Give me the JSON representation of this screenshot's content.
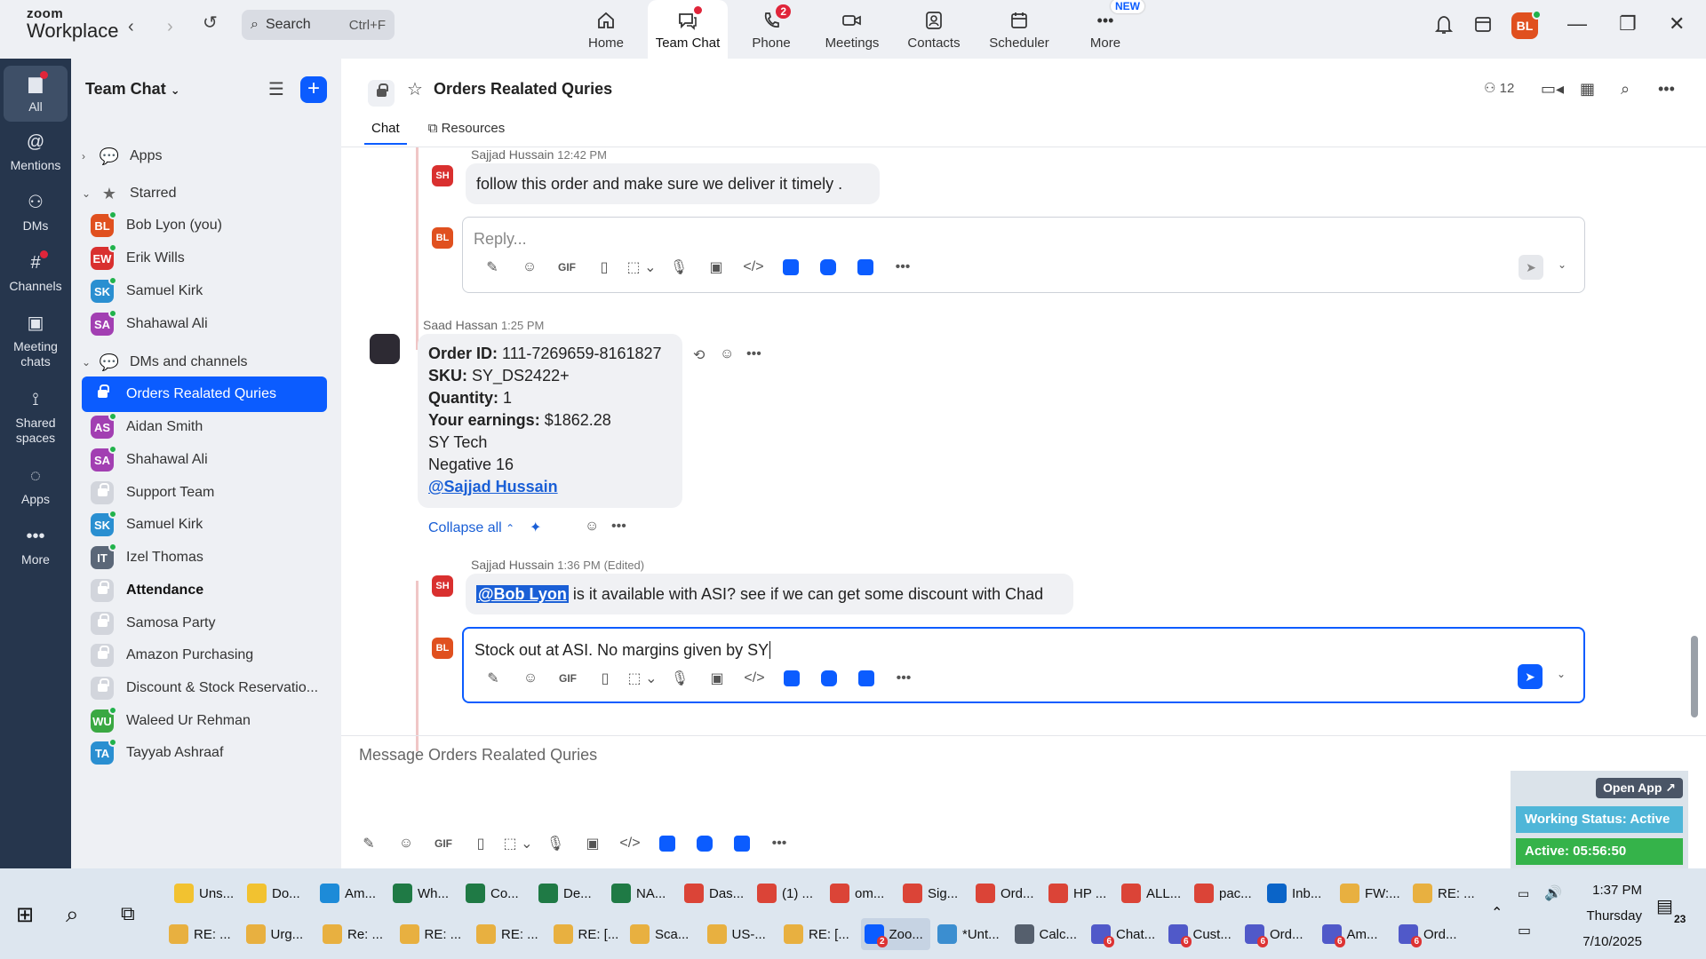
{
  "app": {
    "logo_line1": "zoom",
    "logo_line2": "Workplace"
  },
  "search": {
    "label": "Search",
    "shortcut": "Ctrl+F"
  },
  "nav": [
    {
      "label": "Home",
      "icon": "home-icon"
    },
    {
      "label": "Team Chat",
      "icon": "chat-icon",
      "active": true
    },
    {
      "label": "Phone",
      "icon": "phone-icon",
      "badge": "2"
    },
    {
      "label": "Meetings",
      "icon": "video-icon"
    },
    {
      "label": "Contacts",
      "icon": "contacts-icon"
    },
    {
      "label": "Scheduler",
      "icon": "calendar-icon"
    },
    {
      "label": "More",
      "icon": "more-icon",
      "tag": "NEW"
    }
  ],
  "user": {
    "initials": "BL"
  },
  "rail": [
    {
      "label": "All",
      "icon": "chat-bubble-icon"
    },
    {
      "label": "Mentions",
      "icon": "at-icon"
    },
    {
      "label": "DMs",
      "icon": "people-icon"
    },
    {
      "label": "Channels",
      "icon": "hash-icon"
    },
    {
      "label": "Meeting chats",
      "icon": "calendar-icon"
    },
    {
      "label": "Shared spaces",
      "icon": "share-icon"
    },
    {
      "label": "Apps",
      "icon": "apps-icon"
    },
    {
      "label": "More",
      "icon": "more-icon"
    }
  ],
  "sidebar": {
    "title": "Team Chat",
    "items": [
      {
        "kind": "group",
        "label": "Apps",
        "chevron": "›",
        "icon": "💬"
      },
      {
        "kind": "group",
        "label": "Starred",
        "chevron": "⌄",
        "icon": "★"
      },
      {
        "kind": "user",
        "label": "Bob Lyon (you)",
        "initials": "BL",
        "color": "#e0501f"
      },
      {
        "kind": "user",
        "label": "Erik Wills",
        "initials": "EW",
        "color": "#d9302f"
      },
      {
        "kind": "user",
        "label": "Samuel Kirk",
        "initials": "SK",
        "color": "#2a8fd1"
      },
      {
        "kind": "user",
        "label": "Shahawal Ali",
        "initials": "SA",
        "color": "#a23fb2"
      },
      {
        "kind": "group",
        "label": "DMs and channels",
        "chevron": "⌄",
        "icon": "💬"
      },
      {
        "kind": "channel",
        "label": "Orders Realated Quries",
        "selected": true
      },
      {
        "kind": "user",
        "label": "Aidan Smith",
        "initials": "AS",
        "color": "#a23fb2"
      },
      {
        "kind": "user",
        "label": "Shahawal Ali",
        "initials": "SA",
        "color": "#a23fb2"
      },
      {
        "kind": "channel",
        "label": "Support Team"
      },
      {
        "kind": "user",
        "label": "Samuel Kirk",
        "initials": "SK",
        "color": "#2a8fd1"
      },
      {
        "kind": "user",
        "label": "Izel Thomas",
        "initials": "IT",
        "color": "#5b6778"
      },
      {
        "kind": "channel",
        "label": "Attendance",
        "bold": true
      },
      {
        "kind": "channel",
        "label": "Samosa Party"
      },
      {
        "kind": "channel",
        "label": "Amazon Purchasing"
      },
      {
        "kind": "channel",
        "label": "Discount & Stock Reservatio..."
      },
      {
        "kind": "user",
        "label": "Waleed Ur Rehman",
        "initials": "WU",
        "color": "#3aa842"
      },
      {
        "kind": "user",
        "label": "Tayyab Ashraaf",
        "initials": "TA",
        "color": "#2a8fd1"
      }
    ]
  },
  "channel": {
    "title": "Orders Realated Quries",
    "member_count": "12",
    "tabs": [
      "Chat",
      "Resources"
    ]
  },
  "messages": {
    "m1": {
      "author": "Sajjad Hussain",
      "time": "12:42 PM",
      "initials": "SH",
      "text": "follow this order and make sure we deliver it timely ."
    },
    "reply1": {
      "initials": "BL",
      "placeholder": "Reply..."
    },
    "m2": {
      "author": "Saad Hassan",
      "time": "1:25 PM",
      "order_label": "Order ID:",
      "order_value": "111-7269659-8161827",
      "sku_label": "SKU:",
      "sku_value": "SY_DS2422+",
      "qty_label": "Quantity:",
      "qty_value": "1",
      "earn_label": "Your earnings:",
      "earn_value": "$1862.28",
      "line5": "SY Tech",
      "line6": "Negative 16",
      "mention": "@Sajjad Hussain"
    },
    "collapse": "Collapse all",
    "m3": {
      "author": "Sajjad Hussain",
      "time": "1:36 PM",
      "edited": "(Edited)",
      "initials": "SH",
      "mention": "@Bob Lyon",
      "text": " is it available with ASI? see if we can get some discount with Chad"
    },
    "reply2": {
      "initials": "BL",
      "text": "Stock out at ASI. No margins given by SY"
    }
  },
  "toolbar": {
    "gif": "GIF"
  },
  "compose": {
    "placeholder": "Message Orders Realated Quries"
  },
  "status": {
    "open_app": "Open App ↗",
    "working": "Working Status: Active",
    "active": "Active: 05:56:50"
  },
  "taskbar": {
    "row1": [
      {
        "label": "Uns...",
        "color": "#f2c230"
      },
      {
        "label": "Do...",
        "color": "#f2c230"
      },
      {
        "label": "Am...",
        "color": "#1d8bd8"
      },
      {
        "label": "Wh...",
        "color": "#1f7a45"
      },
      {
        "label": "Co...",
        "color": "#1f7a45"
      },
      {
        "label": "De...",
        "color": "#1f7a45"
      },
      {
        "label": "NA...",
        "color": "#1f7a45"
      },
      {
        "label": "Das...",
        "color": "#db4437"
      },
      {
        "label": "(1) ...",
        "color": "#db4437"
      },
      {
        "label": "om...",
        "color": "#db4437"
      },
      {
        "label": "Sig...",
        "color": "#db4437"
      },
      {
        "label": "Ord...",
        "color": "#db4437"
      },
      {
        "label": "HP ...",
        "color": "#db4437"
      },
      {
        "label": "ALL...",
        "color": "#db4437"
      },
      {
        "label": "pac...",
        "color": "#db4437"
      },
      {
        "label": "Inb...",
        "color": "#0a64c8"
      },
      {
        "label": "FW:...",
        "color": "#e8b040"
      },
      {
        "label": "RE: ...",
        "color": "#e8b040"
      }
    ],
    "row2": [
      {
        "label": "RE: ...",
        "color": "#e8b040"
      },
      {
        "label": "Urg...",
        "color": "#e8b040"
      },
      {
        "label": "Re: ...",
        "color": "#e8b040"
      },
      {
        "label": "RE: ...",
        "color": "#e8b040"
      },
      {
        "label": "RE: ...",
        "color": "#e8b040"
      },
      {
        "label": "RE: [...",
        "color": "#e8b040"
      },
      {
        "label": "Sca...",
        "color": "#e8b040"
      },
      {
        "label": "US-...",
        "color": "#e8b040"
      },
      {
        "label": "RE: [...",
        "color": "#e8b040"
      },
      {
        "label": "Zoo...",
        "color": "#0b5cff",
        "badge": "2",
        "active": true
      },
      {
        "label": "*Unt...",
        "color": "#3b8ed0"
      },
      {
        "label": "Calc...",
        "color": "#555f6d"
      },
      {
        "label": "Chat...",
        "color": "#5059c9",
        "badge": "6"
      },
      {
        "label": "Cust...",
        "color": "#5059c9",
        "badge": "6"
      },
      {
        "label": "Ord...",
        "color": "#5059c9",
        "badge": "6"
      },
      {
        "label": "Am...",
        "color": "#5059c9",
        "badge": "6"
      },
      {
        "label": "Ord...",
        "color": "#5059c9",
        "badge": "6"
      }
    ],
    "time": "1:37 PM",
    "day": "Thursday",
    "date": "7/10/2025",
    "notif_count": "23"
  }
}
